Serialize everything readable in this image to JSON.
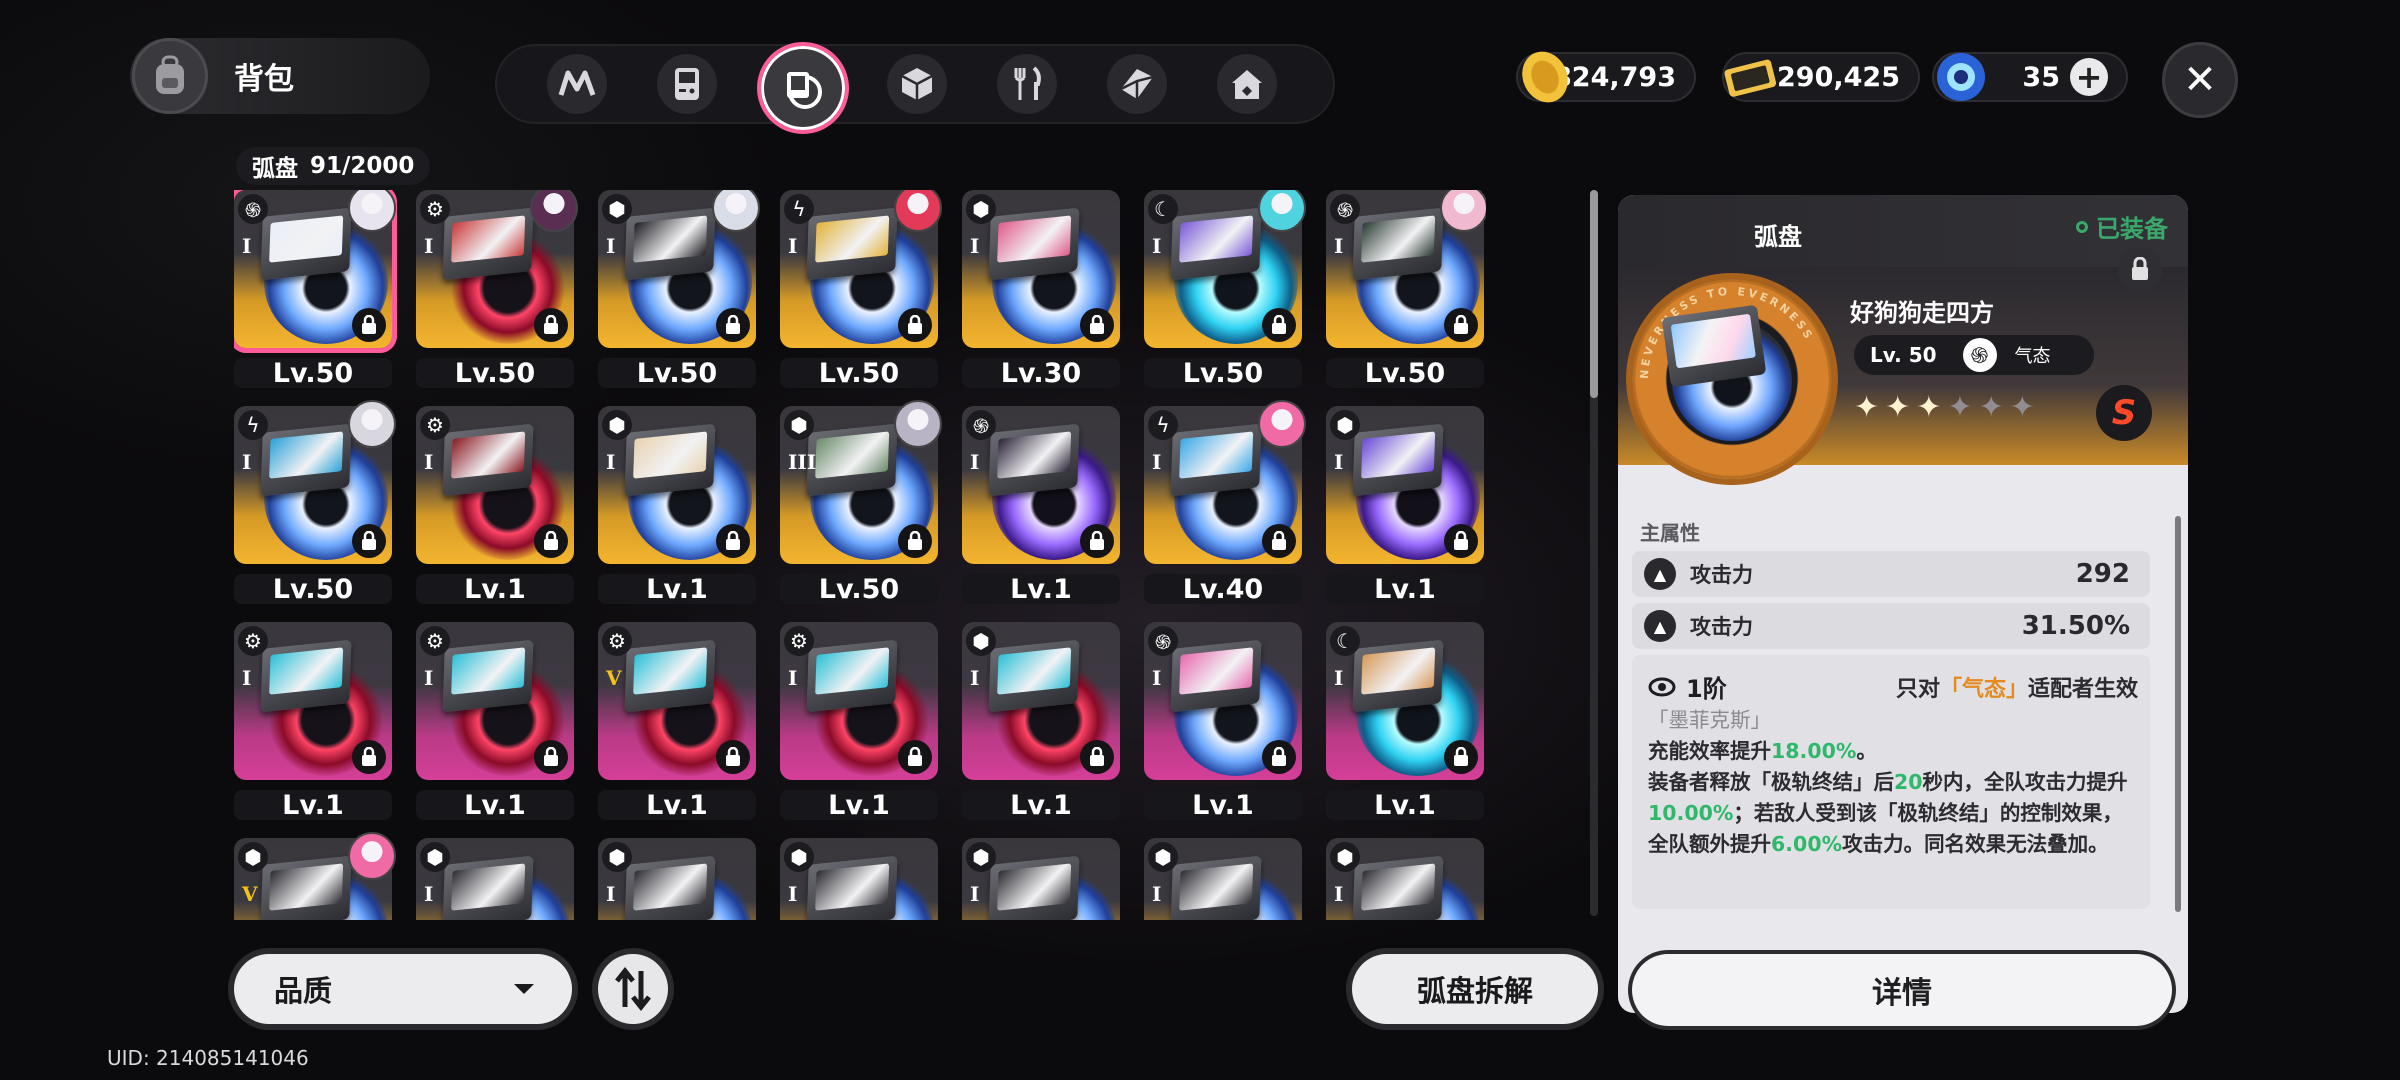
{
  "header": {
    "title": "背包",
    "close_label": "✕",
    "category_tabs": [
      {
        "name": "tab-drive-chips",
        "icon": "n-chip-icon"
      },
      {
        "name": "tab-devices",
        "icon": "gameboy-icon"
      },
      {
        "name": "tab-arc-discs",
        "icon": "arc-disc-icon",
        "active": true
      },
      {
        "name": "tab-materials",
        "icon": "cube-icon"
      },
      {
        "name": "tab-food",
        "icon": "fork-knife-icon"
      },
      {
        "name": "tab-crates",
        "icon": "crate-icon"
      },
      {
        "name": "tab-furniture",
        "icon": "house-icon"
      }
    ],
    "currencies": [
      {
        "name": "gold-coin",
        "icon": "gold-coin-icon",
        "value": "824,793"
      },
      {
        "name": "ticket",
        "icon": "ticket-icon",
        "value": "290,425"
      },
      {
        "name": "crystal",
        "icon": "blue-crystal-icon",
        "value": "35"
      }
    ]
  },
  "inventory": {
    "category_label": "弧盘",
    "count": "91/2000",
    "items": [
      {
        "level": "Lv.50",
        "rarity": "gold",
        "type": "swirl",
        "tier": "I",
        "avatar": "#e7e3ef",
        "disc": "blue",
        "art": "#e9eef8",
        "selected": true
      },
      {
        "level": "Lv.50",
        "rarity": "gold",
        "type": "gear",
        "tier": "I",
        "avatar": "#5a2d52",
        "disc": "red",
        "art": "#c93a3a"
      },
      {
        "level": "Lv.50",
        "rarity": "gold",
        "type": "hex",
        "tier": "I",
        "avatar": "#d8dde8",
        "disc": "blue",
        "art": "#1d1d22"
      },
      {
        "level": "Lv.50",
        "rarity": "gold",
        "type": "bolt",
        "tier": "I",
        "avatar": "#e33a5a",
        "disc": "blue",
        "art": "#e2b23a"
      },
      {
        "level": "Lv.30",
        "rarity": "gold",
        "type": "hex",
        "tier": "I",
        "avatar": "",
        "disc": "blue",
        "art": "#e05a8a"
      },
      {
        "level": "Lv.50",
        "rarity": "gold",
        "type": "moon",
        "tier": "I",
        "avatar": "#4fd3df",
        "disc": "cyan",
        "art": "#7a5ad8"
      },
      {
        "level": "Lv.50",
        "rarity": "gold",
        "type": "swirl",
        "tier": "I",
        "avatar": "#f1b9cf",
        "disc": "blue",
        "art": "#2a3a32"
      },
      {
        "level": "Lv.50",
        "rarity": "gold",
        "type": "bolt",
        "tier": "I",
        "avatar": "#d8d6df",
        "disc": "blue",
        "art": "#2aa2d8"
      },
      {
        "level": "Lv.1",
        "rarity": "gold",
        "type": "gear",
        "tier": "I",
        "avatar": "",
        "disc": "red",
        "art": "#8a1a22"
      },
      {
        "level": "Lv.1",
        "rarity": "gold",
        "type": "hex",
        "tier": "I",
        "avatar": "",
        "disc": "blue",
        "art": "#e8d2b0"
      },
      {
        "level": "Lv.50",
        "rarity": "gold",
        "type": "hex",
        "tier": "III",
        "avatar": "#b8b4c6",
        "disc": "blue",
        "art": "#6a8a6a"
      },
      {
        "level": "Lv.1",
        "rarity": "gold",
        "type": "swirl",
        "tier": "I",
        "avatar": "",
        "disc": "purple",
        "art": "#2a2236"
      },
      {
        "level": "Lv.40",
        "rarity": "gold",
        "type": "bolt",
        "tier": "I",
        "avatar": "#f06aa6",
        "disc": "blue",
        "art": "#3aa8e8"
      },
      {
        "level": "Lv.1",
        "rarity": "gold",
        "type": "hex",
        "tier": "I",
        "avatar": "",
        "disc": "purple",
        "art": "#6a4ad8"
      },
      {
        "level": "Lv.1",
        "rarity": "pink",
        "type": "gear",
        "tier": "I",
        "avatar": "",
        "disc": "red",
        "art": "#2cc0d8"
      },
      {
        "level": "Lv.1",
        "rarity": "pink",
        "type": "gear",
        "tier": "I",
        "avatar": "",
        "disc": "red",
        "art": "#2cc0d8"
      },
      {
        "level": "Lv.1",
        "rarity": "pink",
        "type": "gear",
        "tier": "V",
        "avatar": "",
        "disc": "red",
        "art": "#2cc0d8"
      },
      {
        "level": "Lv.1",
        "rarity": "pink",
        "type": "gear",
        "tier": "I",
        "avatar": "",
        "disc": "red",
        "art": "#2cc0d8"
      },
      {
        "level": "Lv.1",
        "rarity": "pink",
        "type": "hex",
        "tier": "I",
        "avatar": "",
        "disc": "red",
        "art": "#2cc0d8"
      },
      {
        "level": "Lv.1",
        "rarity": "pink",
        "type": "swirl",
        "tier": "I",
        "avatar": "",
        "disc": "blue",
        "art": "#e86ab0"
      },
      {
        "level": "Lv.1",
        "rarity": "pink",
        "type": "moon",
        "tier": "I",
        "avatar": "",
        "disc": "cyan",
        "art": "#d89a5a"
      },
      {
        "level": "",
        "rarity": "gold",
        "type": "hex",
        "tier": "V",
        "avatar": "#f06aa6",
        "disc": "blue",
        "art": "#2a2a30"
      },
      {
        "level": "",
        "rarity": "gold",
        "type": "hex",
        "tier": "I",
        "avatar": "",
        "disc": "blue",
        "art": "#2a2a30"
      },
      {
        "level": "",
        "rarity": "gold",
        "type": "hex",
        "tier": "I",
        "avatar": "",
        "disc": "blue",
        "art": "#2a2a30"
      },
      {
        "level": "",
        "rarity": "gold",
        "type": "hex",
        "tier": "I",
        "avatar": "",
        "disc": "blue",
        "art": "#2a2a30"
      },
      {
        "level": "",
        "rarity": "gold",
        "type": "hex",
        "tier": "I",
        "avatar": "",
        "disc": "blue",
        "art": "#2a2a30"
      },
      {
        "level": "",
        "rarity": "gold",
        "type": "hex",
        "tier": "I",
        "avatar": "",
        "disc": "blue",
        "art": "#2a2a30"
      },
      {
        "level": "",
        "rarity": "gold",
        "type": "hex",
        "tier": "I",
        "avatar": "",
        "disc": "blue",
        "art": "#2a2a30"
      }
    ]
  },
  "controls": {
    "filter_label": "品质",
    "dismantle_label": "弧盘拆解",
    "uid": "UID: 214085141046"
  },
  "detail": {
    "header_label": "弧盘",
    "equipped_label": "已装备",
    "name": "好狗狗走四方",
    "level": "Lv. 50",
    "attribute": "气态",
    "stars_filled": 3,
    "stars_total": 6,
    "rank_badge": "S",
    "disc_ring_text": "NEVERNESS TO EVERNESS",
    "main_stat_title": "主属性",
    "stats": [
      {
        "label": "攻击力",
        "value": "292"
      },
      {
        "label": "攻击力",
        "value": "31.50%"
      }
    ],
    "effect": {
      "tier": "1阶",
      "condition_prefix": "只对",
      "condition_attr": "「气态」",
      "condition_suffix": "适配者生效",
      "set_name": "「墨菲克斯」",
      "segments": [
        {
          "t": "充能效率提升",
          "c": ""
        },
        {
          "t": "18.00%",
          "c": "grn"
        },
        {
          "t": "。",
          "c": ""
        },
        {
          "t": "\n",
          "c": ""
        },
        {
          "t": "装备者释放「极轨终结」后",
          "c": ""
        },
        {
          "t": "20",
          "c": "grn"
        },
        {
          "t": "秒内，全队攻击力提升",
          "c": ""
        },
        {
          "t": "10.00%",
          "c": "grn"
        },
        {
          "t": "；若敌人受到该「极轨终结」的控制效果，全队额外提升",
          "c": ""
        },
        {
          "t": "6.00%",
          "c": "grn"
        },
        {
          "t": "攻击力。同名效果无法叠加。",
          "c": ""
        }
      ]
    },
    "details_button": "详情"
  },
  "colors": {
    "accent_pink": "#ff5a99",
    "gold": "#f4b52f",
    "equipped_green": "#3aa86a",
    "highlight_green": "#2fb86a",
    "highlight_orange": "#e58a1f"
  }
}
